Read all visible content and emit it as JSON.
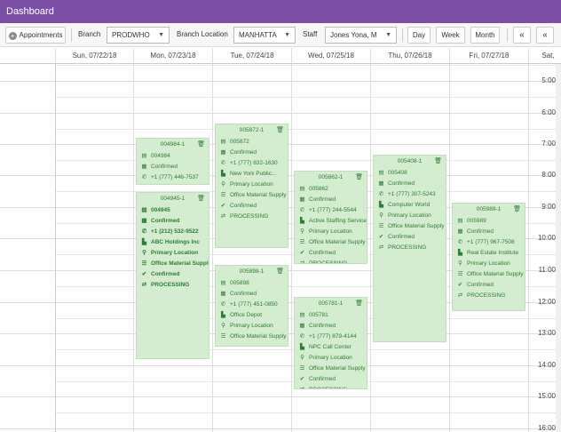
{
  "title": "Dashboard",
  "toolbar": {
    "appointments_label": "Appointments",
    "branch_label": "Branch",
    "branch_value": "PRODWHO",
    "branch_location_label": "Branch Location",
    "branch_location_value": "MANHATTA",
    "staff_label": "Staff",
    "staff_value": "Jones Yona, M",
    "day_label": "Day",
    "week_label": "Week",
    "month_label": "Month",
    "prev_label": "«",
    "next_label": "«"
  },
  "days": [
    "Sun, 07/22/18",
    "Mon, 07/23/18",
    "Tue, 07/24/18",
    "Wed, 07/25/18",
    "Thu, 07/26/18",
    "Fri, 07/27/18",
    "Sat, "
  ],
  "times": [
    "5:00",
    "6:00",
    "7:00",
    "8:00",
    "9:00",
    "10:00",
    "11:00",
    "12:00",
    "13:00",
    "14:00",
    "15:00",
    "16:00"
  ],
  "events": [
    {
      "header": "004984-1",
      "bold": false,
      "rows": [
        {
          "icon": "document-icon",
          "text": "004984"
        },
        {
          "icon": "calendar-icon",
          "text": "Confirmed"
        },
        {
          "icon": "phone-icon",
          "text": "+1 (777) 446-7537"
        }
      ]
    },
    {
      "header": "004945-1",
      "bold": true,
      "rows": [
        {
          "icon": "document-icon",
          "text": "004945"
        },
        {
          "icon": "calendar-icon",
          "text": "Confirmed"
        },
        {
          "icon": "phone-icon",
          "text": "+1 (212) 532-9522"
        },
        {
          "icon": "building-icon",
          "text": "ABC Holdings Inc"
        },
        {
          "icon": "location-icon",
          "text": "Primary Location"
        },
        {
          "icon": "list-icon",
          "text": "Office Material Supply"
        },
        {
          "icon": "check-icon",
          "text": "Confirmed"
        },
        {
          "icon": "processing-icon",
          "text": "PROCESSING"
        }
      ]
    },
    {
      "header": "005872-1",
      "bold": false,
      "rows": [
        {
          "icon": "document-icon",
          "text": "005872"
        },
        {
          "icon": "calendar-icon",
          "text": "Confirmed"
        },
        {
          "icon": "phone-icon",
          "text": "+1 (777) 832-1630"
        },
        {
          "icon": "building-icon",
          "text": "New York Public..."
        },
        {
          "icon": "location-icon",
          "text": "Primary Location"
        },
        {
          "icon": "list-icon",
          "text": "Office Material Supply"
        },
        {
          "icon": "check-icon",
          "text": "Confirmed"
        },
        {
          "icon": "processing-icon",
          "text": "PROCESSING"
        }
      ]
    },
    {
      "header": "005898-1",
      "bold": false,
      "rows": [
        {
          "icon": "document-icon",
          "text": "005898"
        },
        {
          "icon": "calendar-icon",
          "text": "Confirmed"
        },
        {
          "icon": "phone-icon",
          "text": "+1 (777) 451-0850"
        },
        {
          "icon": "building-icon",
          "text": "Office Depot"
        },
        {
          "icon": "location-icon",
          "text": "Primary Location"
        },
        {
          "icon": "list-icon",
          "text": "Office Material Supply"
        }
      ]
    },
    {
      "header": "005862-1",
      "bold": false,
      "rows": [
        {
          "icon": "document-icon",
          "text": "005862"
        },
        {
          "icon": "calendar-icon",
          "text": "Confirmed"
        },
        {
          "icon": "phone-icon",
          "text": "+1 (777) 244-5544"
        },
        {
          "icon": "building-icon",
          "text": "Active Staffing Service"
        },
        {
          "icon": "location-icon",
          "text": "Primary Location"
        },
        {
          "icon": "list-icon",
          "text": "Office Material Supply"
        },
        {
          "icon": "check-icon",
          "text": "Confirmed"
        },
        {
          "icon": "processing-icon",
          "text": "PROCESSING"
        }
      ]
    },
    {
      "header": "005781-1",
      "bold": false,
      "rows": [
        {
          "icon": "document-icon",
          "text": "005781"
        },
        {
          "icon": "calendar-icon",
          "text": "Confirmed"
        },
        {
          "icon": "phone-icon",
          "text": "+1 (777) 879-4144"
        },
        {
          "icon": "building-icon",
          "text": "NPC Call Center"
        },
        {
          "icon": "location-icon",
          "text": "Primary Location"
        },
        {
          "icon": "list-icon",
          "text": "Office Material Supply"
        },
        {
          "icon": "check-icon",
          "text": "Confirmed"
        },
        {
          "icon": "processing-icon",
          "text": "PROCESSING"
        }
      ]
    },
    {
      "header": "005408-1",
      "bold": false,
      "rows": [
        {
          "icon": "document-icon",
          "text": "005408"
        },
        {
          "icon": "calendar-icon",
          "text": "Confirmed"
        },
        {
          "icon": "phone-icon",
          "text": "+1 (777) 307-5243"
        },
        {
          "icon": "building-icon",
          "text": "Computer World"
        },
        {
          "icon": "location-icon",
          "text": "Primary Location"
        },
        {
          "icon": "list-icon",
          "text": "Office Material Supply"
        },
        {
          "icon": "check-icon",
          "text": "Confirmed"
        },
        {
          "icon": "processing-icon",
          "text": "PROCESSING"
        }
      ]
    },
    {
      "header": "005989-1",
      "bold": false,
      "rows": [
        {
          "icon": "document-icon",
          "text": "005989"
        },
        {
          "icon": "calendar-icon",
          "text": "Confirmed"
        },
        {
          "icon": "phone-icon",
          "text": "+1 (777) 967-7508"
        },
        {
          "icon": "building-icon",
          "text": "Real Estate Institute"
        },
        {
          "icon": "location-icon",
          "text": "Primary Location"
        },
        {
          "icon": "list-icon",
          "text": "Office Material Supply"
        },
        {
          "icon": "check-icon",
          "text": "Confirmed"
        },
        {
          "icon": "processing-icon",
          "text": "PROCESSING"
        }
      ]
    }
  ]
}
